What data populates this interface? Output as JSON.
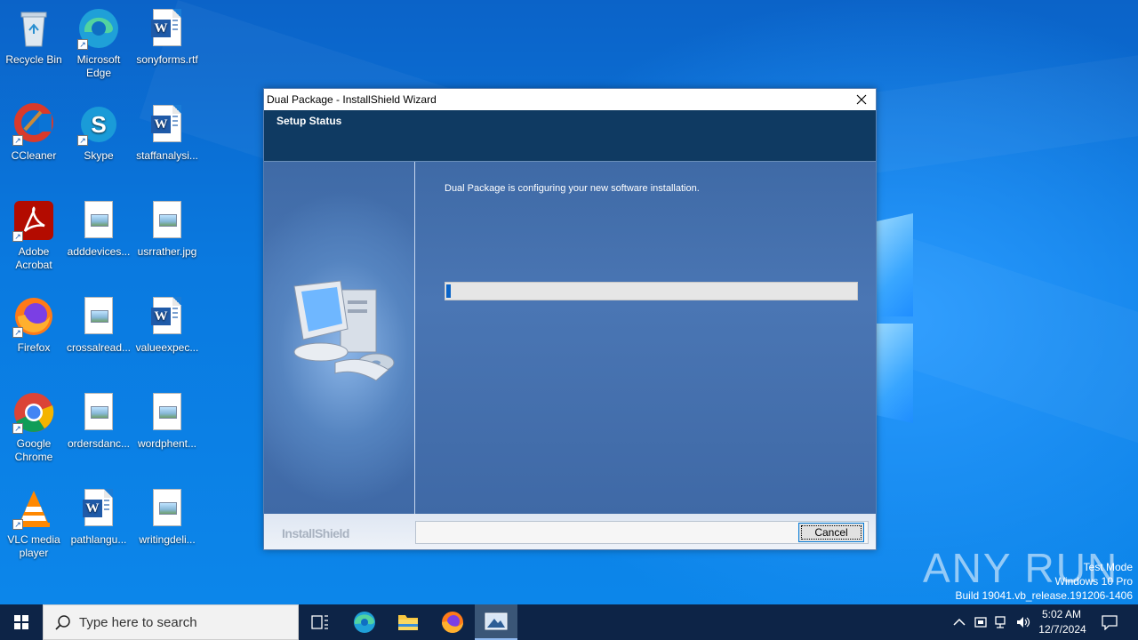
{
  "desktop": {
    "icons": [
      {
        "label": "Recycle Bin",
        "icon": "recycle-bin-icon"
      },
      {
        "label": "Microsoft Edge",
        "icon": "edge-icon"
      },
      {
        "label": "sonyforms.rtf",
        "icon": "word-doc-icon"
      },
      {
        "label": "CCleaner",
        "icon": "ccleaner-icon"
      },
      {
        "label": "Skype",
        "icon": "skype-icon"
      },
      {
        "label": "staffanalysi...",
        "icon": "word-doc-icon"
      },
      {
        "label": "Adobe Acrobat",
        "icon": "acrobat-icon"
      },
      {
        "label": "adddevices...",
        "icon": "image-file-icon"
      },
      {
        "label": "usrrather.jpg",
        "icon": "image-file-icon"
      },
      {
        "label": "Firefox",
        "icon": "firefox-icon"
      },
      {
        "label": "crossalread...",
        "icon": "image-file-icon"
      },
      {
        "label": "valueexpec...",
        "icon": "word-doc-icon"
      },
      {
        "label": "Google Chrome",
        "icon": "chrome-icon"
      },
      {
        "label": "ordersdanc...",
        "icon": "image-file-icon"
      },
      {
        "label": "wordphent...",
        "icon": "image-file-icon"
      },
      {
        "label": "VLC media player",
        "icon": "vlc-icon"
      },
      {
        "label": "pathlangu...",
        "icon": "word-doc-icon"
      },
      {
        "label": "writingdeli...",
        "icon": "image-file-icon"
      }
    ]
  },
  "installer": {
    "window_title": "Dual Package - InstallShield Wizard",
    "header_title": "Setup Status",
    "status_text": "Dual Package is configuring your new software installation.",
    "progress_fraction": 0.01,
    "brand": "InstallShield",
    "cancel_label": "Cancel",
    "accent_color": "#0f3a62"
  },
  "watermark": {
    "line1": "Test Mode",
    "line2": "Windows 10 Pro",
    "line3": "Build 19041.vb_release.191206-1406",
    "logo_text": "ANY RUN"
  },
  "taskbar": {
    "search_placeholder": "Type here to search",
    "time": "5:02 AM",
    "date": "12/7/2024"
  }
}
